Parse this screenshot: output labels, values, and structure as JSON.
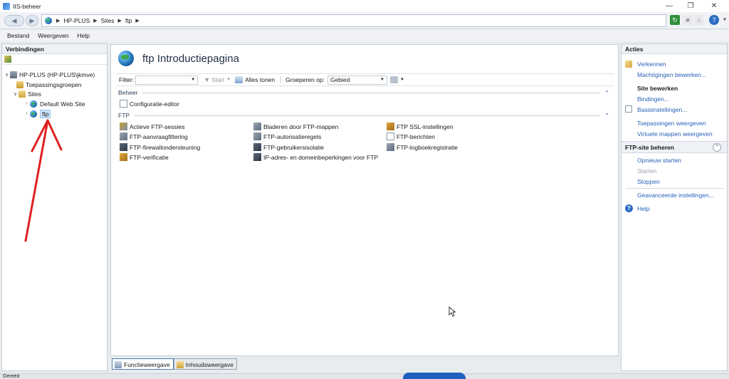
{
  "window": {
    "title": "IIS-beheer"
  },
  "address": {
    "crumbs": [
      "HP-PLUS",
      "Sites",
      "ftp"
    ]
  },
  "menu": [
    "Bestand",
    "Weergeven",
    "Help"
  ],
  "connections": {
    "header": "Verbindingen",
    "tree": {
      "server": "HP-PLUS (HP-PLUS\\jkmve)",
      "app_pools": "Toepassingsgroepen",
      "sites": "Sites",
      "site1": "Default Web Site",
      "site2": "ftp"
    }
  },
  "center": {
    "title": "ftp Introductiepagina",
    "filter": {
      "label": "Filter:",
      "start": "Start",
      "show_all": "Alles tonen",
      "group_label": "Groeperen op:",
      "group_value": "Gebied"
    },
    "groups": {
      "beheer": {
        "label": "Beheer",
        "items": [
          "Configuratie-editor"
        ]
      },
      "ftp": {
        "label": "FTP",
        "items": [
          "Actieve FTP-sessies",
          "Bladeren door FTP-mappen",
          "FTP SSL-instellingen",
          "FTP-aanvraagfiltering",
          "FTP-autorisatieregels",
          "FTP-berichten",
          "FTP-firewallondersteuning",
          "FTP-gebruikersisolatie",
          "FTP-logboekregistratie",
          "FTP-verificatie",
          "IP-adres- en domeinbeperkingen voor FTP"
        ]
      }
    }
  },
  "tabs": {
    "features": "Functieweergave",
    "content": "Inhoudsweergave"
  },
  "actions": {
    "header": "Acties",
    "explore": "Verkennen",
    "edit_perms": "Machtigingen bewerken...",
    "edit_site": "Site bewerken",
    "bindings": "Bindingen...",
    "basic": "Basisinstellingen...",
    "view_apps": "Toepassingen weergeven",
    "view_vdirs": "Virtuele mappen weergeven",
    "ftp_manage": "FTP-site beheren",
    "restart": "Opnieuw starten",
    "start": "Starten",
    "stop": "Stoppen",
    "advanced": "Geavanceerde instellingen...",
    "help": "Help"
  },
  "status": {
    "text": "Gereed"
  },
  "colors": {
    "link": "#2a62b8",
    "annotation_arrow": "#e02020"
  }
}
